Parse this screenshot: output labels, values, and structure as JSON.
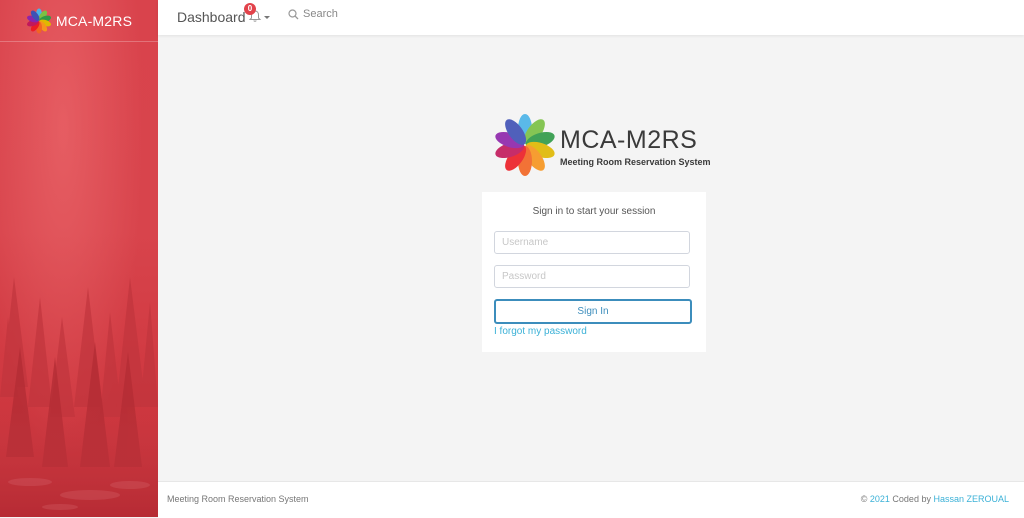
{
  "sidebar": {
    "brand": "MCA-M2RS"
  },
  "navbar": {
    "title": "Dashboard",
    "notification_count": "0",
    "search_label": "Search"
  },
  "logo": {
    "title": "MCA-M2RS",
    "subtitle": "Meeting Room Reservation System"
  },
  "login": {
    "message": "Sign in to start your session",
    "username_placeholder": "Username",
    "password_placeholder": "Password",
    "signin_label": "Sign In",
    "forgot_label": "I forgot my password"
  },
  "footer": {
    "left_text": "Meeting Room Reservation System",
    "copyright": "©",
    "year": "2021",
    "coded_by": "Coded by",
    "author": "Hassan ZEROUAL"
  },
  "icons": {
    "flower_logo": "flower-logo-icon",
    "notification": "bell-icon",
    "search": "search-icon"
  }
}
